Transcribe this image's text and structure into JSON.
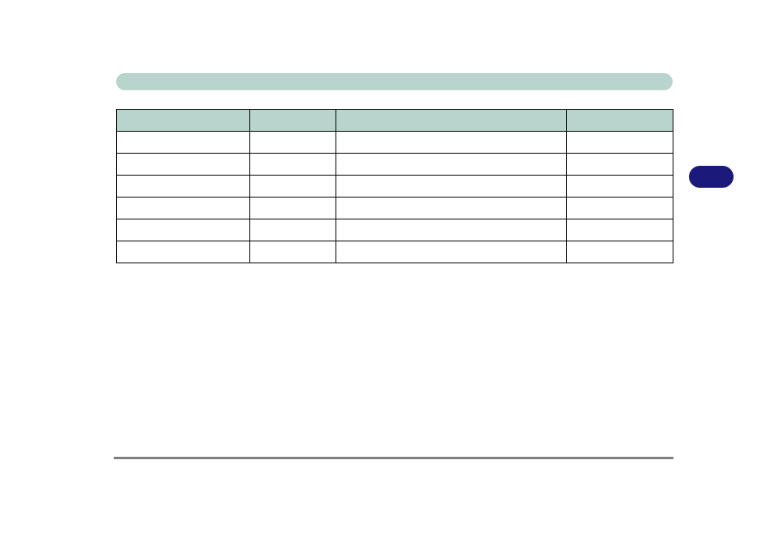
{
  "header": {
    "title": ""
  },
  "table": {
    "columns": [
      "",
      "",
      "",
      ""
    ],
    "rows": [
      [
        "",
        "",
        "",
        ""
      ],
      [
        "",
        "",
        "",
        ""
      ],
      [
        "",
        "",
        "",
        ""
      ],
      [
        "",
        "",
        "",
        ""
      ],
      [
        "",
        "",
        "",
        ""
      ],
      [
        "",
        "",
        "",
        ""
      ]
    ]
  },
  "side_tab": {
    "label": ""
  },
  "footer": {
    "text": ""
  },
  "colors": {
    "header_bg": "#b9d4cd",
    "side_tab_bg": "#1b1a7a",
    "rule": "#808080"
  }
}
